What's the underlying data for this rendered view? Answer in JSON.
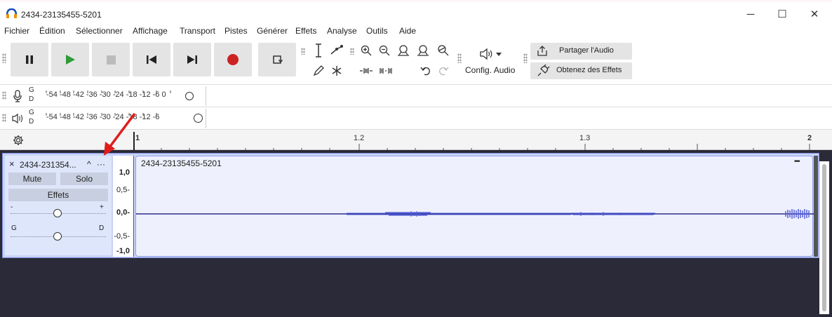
{
  "window": {
    "title": "2434-23135455-5201",
    "minimize": "─",
    "maximize": "☐",
    "close": "✕"
  },
  "menu": [
    "Fichier",
    "Édition",
    "Sélectionner",
    "Affichage",
    "Transport",
    "Pistes",
    "Générer",
    "Effets",
    "Analyse",
    "Outils",
    "Aide"
  ],
  "toolbar": {
    "audio_setup_label": "Config. Audio",
    "share_audio_label": "Partager l'Audio",
    "get_effects_label": "Obtenez des Effets"
  },
  "meters": {
    "record": {
      "channels_top": "G",
      "channels_bottom": "D",
      "scale": "-54 -48 -42 -36 -30 -24 -18 -12 -6 0"
    },
    "playback": {
      "channels_top": "G",
      "channels_bottom": "D",
      "scale": "-54 -48 -42 -36 -30 -24 -18 -12 -6"
    }
  },
  "ruler": {
    "labels": [
      "1",
      "1.2",
      "1.3",
      "2"
    ]
  },
  "track": {
    "name": "2434-231354...",
    "collapse_glyph": "^",
    "menu_glyph": "···",
    "mute_label": "Mute",
    "solo_label": "Solo",
    "effects_label": "Effets",
    "gain_minus": "-",
    "gain_plus": "+",
    "pan_left": "G",
    "pan_right": "D",
    "scale": [
      "1,0",
      "0,5-",
      "0,0-",
      "-0,5-",
      "-1,0"
    ],
    "clip_name": "2434-23135455-5201",
    "clip_menu": "•••"
  },
  "colors": {
    "accent_red": "#e01b1b",
    "waveform": "#5560d8",
    "clip_bg": "#eef1fd",
    "record": "#c22222"
  }
}
